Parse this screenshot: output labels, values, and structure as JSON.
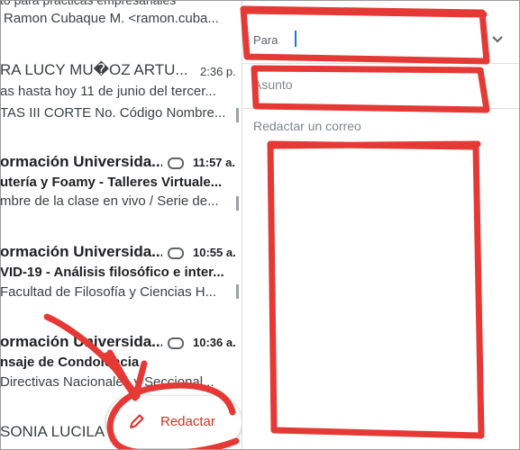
{
  "inbox": {
    "rows": [
      {
        "sender": "to para prácticas empresariales",
        "subject": "",
        "snippet": "Ramon Cubaque M. <ramon.cuba...",
        "time": ""
      },
      {
        "sender": "RA LUCY MU�OZ ARTU...",
        "subject": "",
        "snippet": "as hasta hoy 11 de junio del tercer...",
        "snippet2": "TAS III CORTE No. Código Nombre...",
        "time": "2:36 p."
      },
      {
        "sender": "ormación Universida...",
        "subject": "utería y Foamy - Talleres Virtuale...",
        "snippet": "mbre de la clase en vivo / Serie de...",
        "time": "11:57 a."
      },
      {
        "sender": "ormación Universida...",
        "subject": "VID-19 - Análisis filosófico e inter...",
        "snippet": "Facultad de Filosofía y Ciencias H...",
        "time": "10:55 a."
      },
      {
        "sender": "ormación Universida...",
        "subject": "nsaje de Condolencia",
        "snippet": "Directivas Nacionales y Seccional...",
        "time": "10:36 a."
      },
      {
        "sender": "SONIA LUCILA",
        "subject": "",
        "snippet": "",
        "time": ""
      }
    ],
    "compose_label": "Redactar"
  },
  "compose": {
    "to_label": "Para",
    "subject_placeholder": "Asunto",
    "body_placeholder": "Redactar un correo"
  },
  "colors": {
    "accent": "#d93025",
    "annotation": "#e53935",
    "caret": "#1a73e8"
  }
}
